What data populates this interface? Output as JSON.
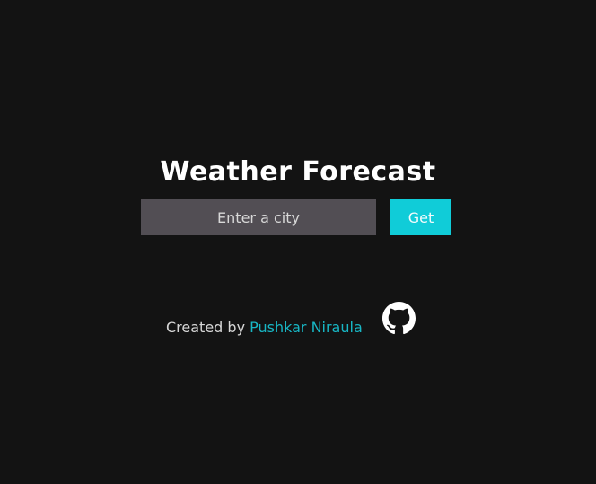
{
  "header": {
    "title": "Weather Forecast"
  },
  "search": {
    "placeholder": "Enter a city",
    "value": "",
    "button_label": "Get"
  },
  "footer": {
    "created_by_text": "Created by",
    "author_name": "Pushkar Niraula",
    "github_icon": "github-icon"
  },
  "colors": {
    "background": "#131313",
    "input_background": "#524e54",
    "accent": "#10ccd8",
    "link": "#18b6c4",
    "text": "#ffffff"
  }
}
